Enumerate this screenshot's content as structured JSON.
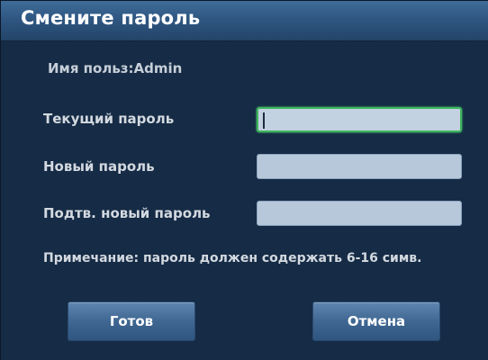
{
  "dialog": {
    "title": "Смените пароль",
    "user_line": "Имя польз:Admin",
    "fields": [
      {
        "label": "Текущий пароль",
        "value": "",
        "active": true
      },
      {
        "label": "Новый пароль",
        "value": "",
        "active": false
      },
      {
        "label": "Подтв. новый пароль",
        "value": "",
        "active": false
      }
    ],
    "note": "Примечание: пароль должен содержать 6-16 симв.",
    "buttons": {
      "ok_label": "Готов",
      "cancel_label": "Отмена"
    }
  },
  "colors": {
    "title_bar": "#2f5782",
    "background": "#162b45",
    "field_fill": "#b6c8da",
    "active_field_border": "#3fb65d",
    "button": "#3f6792"
  }
}
